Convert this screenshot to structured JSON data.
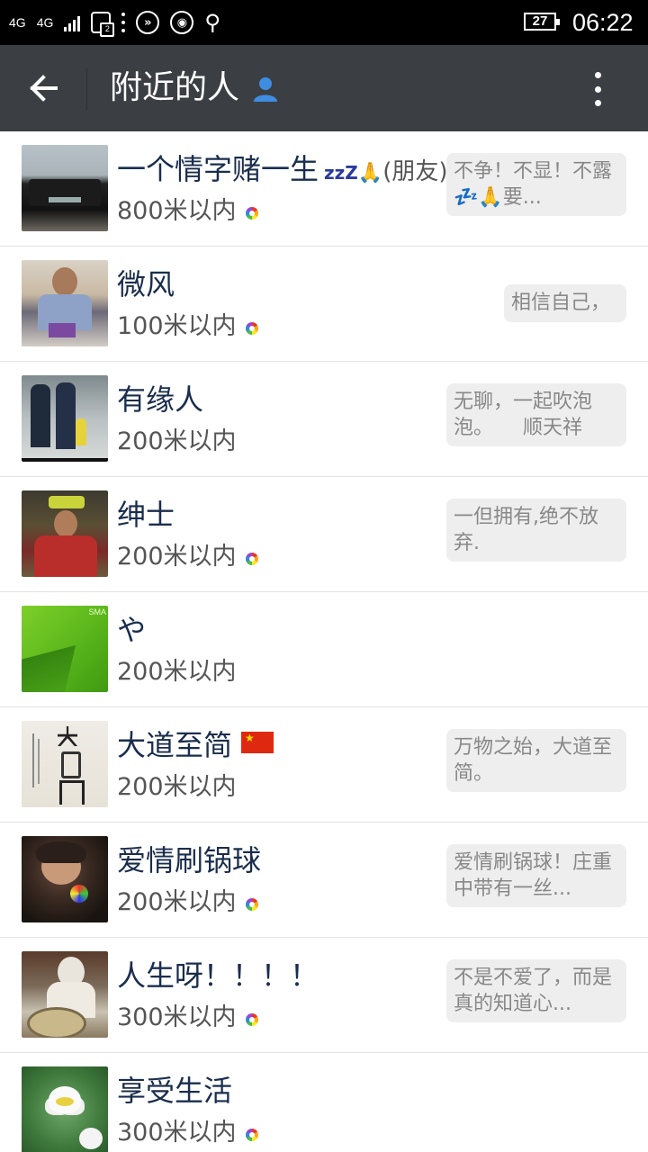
{
  "status_bar": {
    "network1": "4G",
    "network2": "4G",
    "battery": "27",
    "time": "06:22"
  },
  "app_bar": {
    "title": "附近的人",
    "back_icon": "arrow-left-icon",
    "menu_icon": "more-vertical-icon"
  },
  "people": [
    {
      "name": "一个情字赌一生",
      "name_suffix": "(朋友)",
      "distance": "800米以内",
      "signature": "不争！不显！不露💤🙏要...",
      "has_wheel": true,
      "has_z": true
    },
    {
      "name": "微风",
      "distance": "100米以内",
      "signature": "相信自己，",
      "has_wheel": true
    },
    {
      "name": "有缘人",
      "distance": "200米以内",
      "signature": "无聊，一起吹泡泡。　　顺天祥",
      "has_wheel": false
    },
    {
      "name": "绅士",
      "distance": "200米以内",
      "signature": "一但拥有,绝不放弃.",
      "has_wheel": true
    },
    {
      "name": "や",
      "distance": "200米以内",
      "signature": "",
      "has_wheel": false
    },
    {
      "name": "大道至简",
      "distance": "200米以内",
      "signature": "万物之始，大道至简。",
      "has_wheel": false,
      "has_flag": true
    },
    {
      "name": "爱情刷锅球",
      "distance": "200米以内",
      "signature": "爱情刷锅球！庄重中带有一丝...",
      "has_wheel": true
    },
    {
      "name": "人生呀！！！！",
      "distance": "300米以内",
      "signature": "不是不爱了，而是真的知道心...",
      "has_wheel": true
    },
    {
      "name": "享受生活",
      "distance": "300米以内",
      "signature": "",
      "has_wheel": true
    }
  ],
  "colors": {
    "status_bar_bg": "#000000",
    "app_bar_bg": "#3b3f44",
    "name_text": "#1a2d4d",
    "distance_text": "#555555",
    "bubble_bg": "#eeeeee"
  }
}
